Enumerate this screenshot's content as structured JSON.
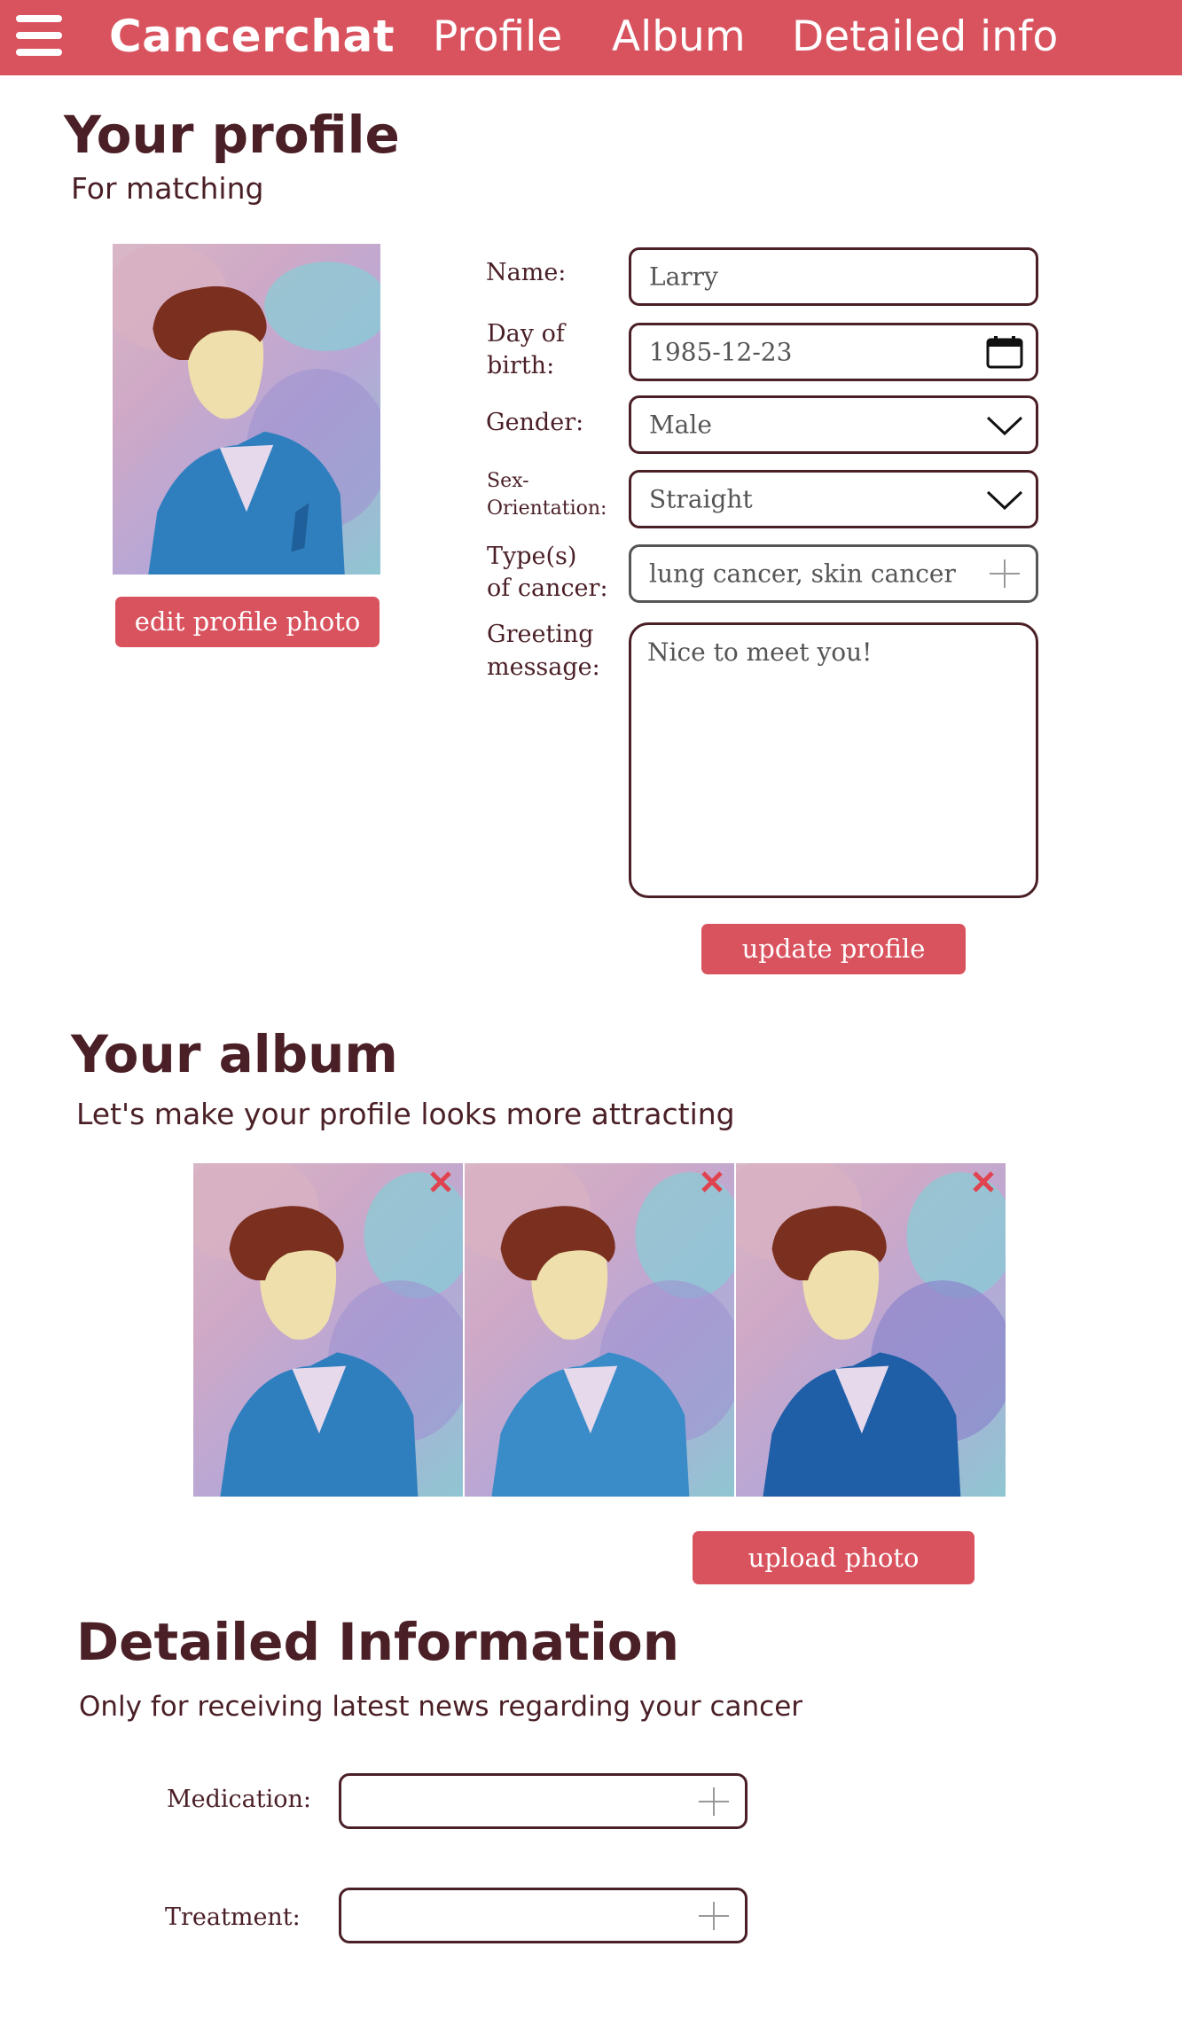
{
  "nav": {
    "menu_icon": "hamburger-menu-icon",
    "brand": "Cancerchat",
    "links": [
      "Profile",
      "Album",
      "Detailed info"
    ],
    "color": "#d9535f"
  },
  "profile": {
    "title": "Your profile",
    "subtitle": "For matching",
    "edit_photo_label": "edit profile photo",
    "fields": {
      "name": {
        "label": "Name:",
        "value": "Larry"
      },
      "dob": {
        "label_line1": "Day of",
        "label_line2": "birth:",
        "value": "1985-12-23",
        "icon": "calendar-icon"
      },
      "gender": {
        "label": "Gender:",
        "value": "Male",
        "icon": "chevron-down-icon"
      },
      "orientation": {
        "label_line1": "Sex-",
        "label_line2": "Orientation:",
        "value": "Straight",
        "icon": "chevron-down-icon"
      },
      "cancer_types": {
        "label_line1": "Type(s)",
        "label_line2": "of cancer:",
        "value": "lung cancer, skin cancer",
        "icon": "plus-icon"
      },
      "greeting": {
        "label_line1": "Greeting",
        "label_line2": "message:",
        "value": "Nice to meet you!"
      }
    },
    "update_label": "update profile"
  },
  "album": {
    "title": "Your album",
    "subtitle": "Let's make your profile looks more attracting",
    "photo_count": 3,
    "remove_icon": "close-icon",
    "upload_label": "upload photo"
  },
  "detailed": {
    "title": "Detailed Information",
    "subtitle": "Only for receiving latest news regarding your cancer",
    "medication_label": "Medication:",
    "medication_value": "",
    "treatment_label": "Treatment:",
    "treatment_value": "",
    "field_icon": "plus-icon"
  },
  "colors": {
    "accent": "#d9535f",
    "text": "#4a1f26",
    "remove_x": "#e0434f"
  }
}
